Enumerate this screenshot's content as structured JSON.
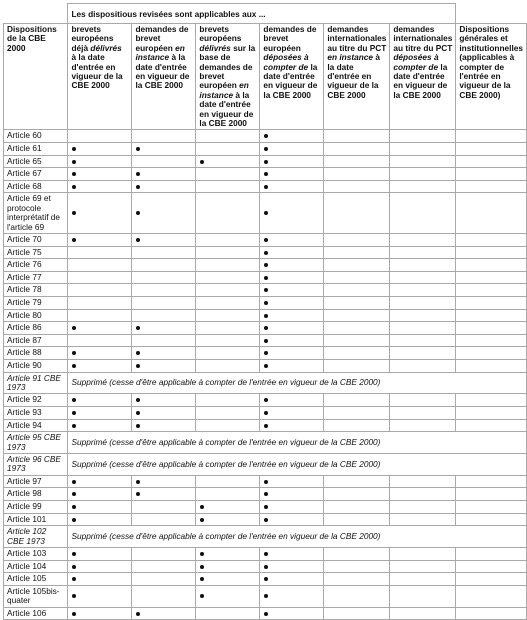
{
  "table": {
    "super_header": "Les dispositious revisées sont applicables aux ...",
    "first_col_header": "Dispositions de la CBE 2000",
    "columns": [
      {
        "parts": [
          {
            "t": "brevets européens déjà ",
            "i": false
          },
          {
            "t": "délivrés",
            "i": true
          },
          {
            "t": " à la date d'entrée en vigueur de la CBE 2000",
            "i": false
          }
        ]
      },
      {
        "parts": [
          {
            "t": "demandes de brevet européen ",
            "i": false
          },
          {
            "t": "en instance",
            "i": true
          },
          {
            "t": " à la date d'entrée en vigueur de la CBE 2000",
            "i": false
          }
        ]
      },
      {
        "parts": [
          {
            "t": "brevets européens ",
            "i": false
          },
          {
            "t": "délivrés",
            "i": true
          },
          {
            "t": " sur la base de demandes de brevet européen ",
            "i": false
          },
          {
            "t": "en instance",
            "i": true
          },
          {
            "t": " à la date d'entrée en vigueur de la CBE 2000",
            "i": false
          }
        ]
      },
      {
        "parts": [
          {
            "t": "demandes de brevet européen ",
            "i": false
          },
          {
            "t": "déposées à compter de",
            "i": true
          },
          {
            "t": " la date d'entrée en vigueur de la CBE 2000",
            "i": false
          }
        ]
      },
      {
        "parts": [
          {
            "t": "demandes internationales au titre du PCT ",
            "i": false
          },
          {
            "t": "en instance",
            "i": true
          },
          {
            "t": " à la date d'entrée en vigueur de la CBE 2000",
            "i": false
          }
        ]
      },
      {
        "parts": [
          {
            "t": "demandes internationales au titre du PCT ",
            "i": false
          },
          {
            "t": "déposées à compter de",
            "i": true
          },
          {
            "t": " la date d'entrée en vigueur de la CBE 2000",
            "i": false
          }
        ]
      },
      {
        "parts": [
          {
            "t": "Dispositions générales et institutionnelles (applicables à compter de l'entrée en vigueur de la CBE 2000)",
            "i": false
          }
        ]
      }
    ],
    "suppressed_text": "Supprimé (cesse d'être applicable à compter de l'entrée en vigueur de la CBE 2000)",
    "bullet_symbol": "●",
    "rows": [
      {
        "article": "Article 60",
        "marks": [
          0,
          0,
          0,
          1,
          0,
          0,
          0
        ]
      },
      {
        "article": "Article 61",
        "marks": [
          1,
          1,
          0,
          1,
          0,
          0,
          0
        ]
      },
      {
        "article": "Article 65",
        "marks": [
          1,
          0,
          1,
          1,
          0,
          0,
          0
        ]
      },
      {
        "article": "Article 67",
        "marks": [
          1,
          1,
          0,
          1,
          0,
          0,
          0
        ]
      },
      {
        "article": "Article 68",
        "marks": [
          1,
          1,
          0,
          1,
          0,
          0,
          0
        ]
      },
      {
        "article": "Article 69 et protocole interprétatif de l'article 69",
        "marks": [
          1,
          1,
          0,
          1,
          0,
          0,
          0
        ]
      },
      {
        "article": "Article 70",
        "marks": [
          1,
          1,
          0,
          1,
          0,
          0,
          0
        ]
      },
      {
        "article": "Article 75",
        "marks": [
          0,
          0,
          0,
          1,
          0,
          0,
          0
        ]
      },
      {
        "article": "Article 76",
        "marks": [
          0,
          0,
          0,
          1,
          0,
          0,
          0
        ]
      },
      {
        "article": "Article 77",
        "marks": [
          0,
          0,
          0,
          1,
          0,
          0,
          0
        ]
      },
      {
        "article": "Article 78",
        "marks": [
          0,
          0,
          0,
          1,
          0,
          0,
          0
        ]
      },
      {
        "article": "Article 79",
        "marks": [
          0,
          0,
          0,
          1,
          0,
          0,
          0
        ]
      },
      {
        "article": "Article 80",
        "marks": [
          0,
          0,
          0,
          1,
          0,
          0,
          0
        ]
      },
      {
        "article": "Article 86",
        "marks": [
          1,
          1,
          0,
          1,
          0,
          0,
          0
        ]
      },
      {
        "article": "Article 87",
        "marks": [
          0,
          0,
          0,
          1,
          0,
          0,
          0
        ]
      },
      {
        "article": "Article 88",
        "marks": [
          1,
          1,
          0,
          1,
          0,
          0,
          0
        ]
      },
      {
        "article": "Article 90",
        "marks": [
          1,
          1,
          0,
          1,
          0,
          0,
          0
        ]
      },
      {
        "article": "Article 91 CBE 1973",
        "suppressed": true
      },
      {
        "article": "Article 92",
        "marks": [
          1,
          1,
          0,
          1,
          0,
          0,
          0
        ]
      },
      {
        "article": "Article 93",
        "marks": [
          1,
          1,
          0,
          1,
          0,
          0,
          0
        ]
      },
      {
        "article": "Article 94",
        "marks": [
          1,
          1,
          0,
          1,
          0,
          0,
          0
        ]
      },
      {
        "article": "Article 95 CBE 1973",
        "suppressed": true
      },
      {
        "article": "Article 96 CBE 1973",
        "suppressed": true
      },
      {
        "article": "Article 97",
        "marks": [
          1,
          1,
          0,
          1,
          0,
          0,
          0
        ]
      },
      {
        "article": "Article 98",
        "marks": [
          1,
          1,
          0,
          1,
          0,
          0,
          0
        ]
      },
      {
        "article": "Article 99",
        "marks": [
          1,
          0,
          1,
          1,
          0,
          0,
          0
        ]
      },
      {
        "article": "Article 101",
        "marks": [
          1,
          0,
          1,
          1,
          0,
          0,
          0
        ]
      },
      {
        "article": "Article 102 CBE 1973",
        "suppressed": true
      },
      {
        "article": "Article 103",
        "marks": [
          1,
          0,
          1,
          1,
          0,
          0,
          0
        ]
      },
      {
        "article": "Article 104",
        "marks": [
          1,
          0,
          1,
          1,
          0,
          0,
          0
        ]
      },
      {
        "article": "Article 105",
        "marks": [
          1,
          0,
          1,
          1,
          0,
          0,
          0
        ]
      },
      {
        "article": "Article 105bis-quater",
        "marks": [
          1,
          0,
          1,
          1,
          0,
          0,
          0
        ]
      },
      {
        "article": "Article 106",
        "marks": [
          1,
          1,
          0,
          1,
          0,
          0,
          0
        ]
      }
    ]
  }
}
